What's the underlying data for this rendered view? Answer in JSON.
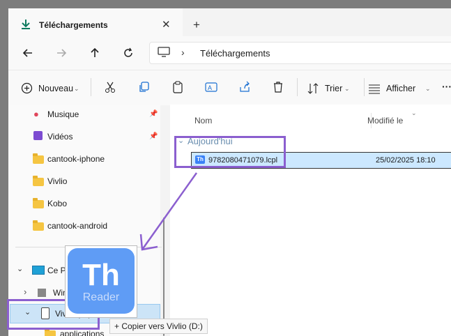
{
  "window": {
    "tab_title": "Téléchargements",
    "address_path": "Téléchargements"
  },
  "toolbar": {
    "new_label": "Nouveau",
    "sort_label": "Trier",
    "view_label": "Afficher",
    "more_label": "···"
  },
  "sidebar": {
    "items": [
      {
        "label": "Musique",
        "icon": "music-icon",
        "pinned": true
      },
      {
        "label": "Vidéos",
        "icon": "video-icon",
        "pinned": true
      },
      {
        "label": "cantook-iphone",
        "icon": "folder-icon"
      },
      {
        "label": "Vivlio",
        "icon": "folder-icon"
      },
      {
        "label": "Kobo",
        "icon": "folder-icon"
      },
      {
        "label": "cantook-android",
        "icon": "folder-icon"
      }
    ],
    "this_pc_label": "Ce PC",
    "windows_label": "Windows",
    "vivlio_drive_label": "Vivlio (D:)",
    "sub_label": "applications"
  },
  "content": {
    "columns": [
      "Nom",
      "Modifié le"
    ],
    "group_label": "Aujourd'hui",
    "files": [
      {
        "name": "9782080471079.lcpl",
        "modified": "25/02/2025 18:10"
      }
    ]
  },
  "drag": {
    "icon_title": "Th",
    "icon_subtitle": "Reader",
    "tooltip": "+ Copier vers Vivlio (D:)"
  },
  "colors": {
    "accent": "#0f7b5f",
    "selection": "#cce8ff",
    "annotation": "#8b5fcf",
    "folder": "#f5c542"
  }
}
